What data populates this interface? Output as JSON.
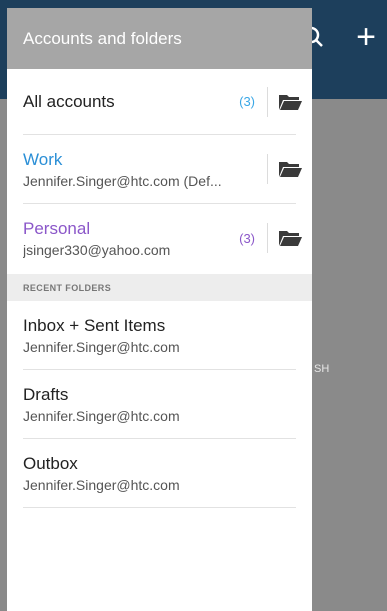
{
  "drawer": {
    "title": "Accounts and folders",
    "accounts": [
      {
        "name": "All accounts",
        "email": "",
        "count": "(3)",
        "name_color": "#222222",
        "count_color": "#3aa7e6"
      },
      {
        "name": "Work",
        "email": "Jennifer.Singer@htc.com (Def...",
        "count": "",
        "name_color": "#2b8fd6",
        "count_color": "#3aa7e6"
      },
      {
        "name": "Personal",
        "email": "jsinger330@yahoo.com",
        "count": "(3)",
        "name_color": "#8b57c9",
        "count_color": "#8b57c9"
      }
    ],
    "section_header": "RECENT FOLDERS",
    "recent_folders": [
      {
        "name": "Inbox + Sent Items",
        "email": "Jennifer.Singer@htc.com"
      },
      {
        "name": "Drafts",
        "email": "Jennifer.Singer@htc.com"
      },
      {
        "name": "Outbox",
        "email": "Jennifer.Singer@htc.com"
      }
    ]
  },
  "background": {
    "appbar_color": "#1d3f5c",
    "plus_glyph": "+",
    "list_text": "SH",
    "icons": [
      "search-icon",
      "plus-icon"
    ]
  },
  "colors": {
    "header_bg": "#a6a6a6",
    "section_bg": "#ededed",
    "scrim": "#8a8a8a",
    "folder_icon": "#3a3a3a"
  }
}
